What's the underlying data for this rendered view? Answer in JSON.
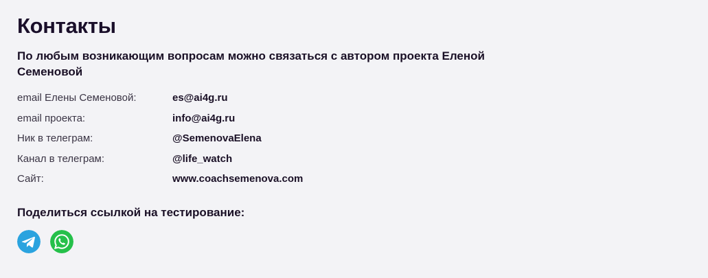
{
  "heading": "Контакты",
  "intro": "По любым возникающим вопросам можно связаться с автором проекта Еленой Семеновой",
  "contacts": [
    {
      "label": "email Елены Семеновой:",
      "value": "es@ai4g.ru"
    },
    {
      "label": "email проекта:",
      "value": "info@ai4g.ru"
    },
    {
      "label": "Ник в телеграм:",
      "value": "@SemenovaElena"
    },
    {
      "label": "Канал в телеграм:",
      "value": "@life_watch"
    },
    {
      "label": "Сайт:",
      "value": "www.coachsemenova.com"
    }
  ],
  "share": {
    "title": "Поделиться ссылкой на тестирование:",
    "icons": [
      {
        "name": "telegram-icon",
        "color": "#2aa3df"
      },
      {
        "name": "whatsapp-icon",
        "color": "#25c04a"
      }
    ]
  }
}
